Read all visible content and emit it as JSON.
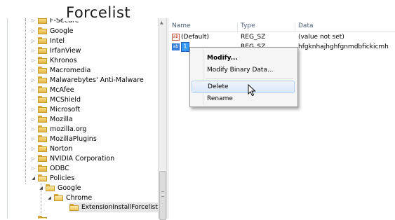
{
  "caption": "Forcelist",
  "tree": {
    "items": [
      {
        "label": "F-Secure",
        "depth": 0,
        "expander": "right",
        "open": false
      },
      {
        "label": "Google",
        "depth": 0,
        "expander": "right",
        "open": false
      },
      {
        "label": "Intel",
        "depth": 0,
        "expander": "right",
        "open": false
      },
      {
        "label": "IrfanView",
        "depth": 0,
        "expander": "right",
        "open": false
      },
      {
        "label": "Khronos",
        "depth": 0,
        "expander": "right",
        "open": false
      },
      {
        "label": "Macromedia",
        "depth": 0,
        "expander": "right",
        "open": false
      },
      {
        "label": "Malwarebytes' Anti-Malware",
        "depth": 0,
        "expander": "right",
        "open": false
      },
      {
        "label": "McAfee",
        "depth": 0,
        "expander": "right",
        "open": false
      },
      {
        "label": "MCShield",
        "depth": 0,
        "expander": "none",
        "open": false
      },
      {
        "label": "Microsoft",
        "depth": 0,
        "expander": "right",
        "open": false
      },
      {
        "label": "Mozilla",
        "depth": 0,
        "expander": "right",
        "open": false
      },
      {
        "label": "mozilla.org",
        "depth": 0,
        "expander": "right",
        "open": false
      },
      {
        "label": "MozillaPlugins",
        "depth": 0,
        "expander": "right",
        "open": false
      },
      {
        "label": "Norton",
        "depth": 0,
        "expander": "right",
        "open": false
      },
      {
        "label": "NVIDIA Corporation",
        "depth": 0,
        "expander": "right",
        "open": false
      },
      {
        "label": "ODBC",
        "depth": 0,
        "expander": "right",
        "open": false
      },
      {
        "label": "Policies",
        "depth": 0,
        "expander": "down",
        "open": true
      },
      {
        "label": "Google",
        "depth": 1,
        "expander": "down",
        "open": true
      },
      {
        "label": "Chrome",
        "depth": 2,
        "expander": "down",
        "open": true
      },
      {
        "label": "ExtensionInstallForcelist",
        "depth": 3,
        "expander": "none",
        "open": true,
        "selected": true
      }
    ]
  },
  "values": {
    "columns": [
      "Name",
      "Type",
      "Data"
    ],
    "rows": [
      {
        "name": "(Default)",
        "type": "REG_SZ",
        "data": "(value not set)"
      },
      {
        "name": "1",
        "type": "REG_SZ",
        "data": "hfgknhajhghfgnmdbfickicmh"
      }
    ]
  },
  "context_menu": {
    "items": [
      {
        "label": "Modify...",
        "bold": true
      },
      {
        "label": "Modify Binary Data...",
        "bold": false
      },
      {
        "label": "Delete",
        "bold": false,
        "hover": true
      },
      {
        "label": "Rename",
        "bold": false
      }
    ]
  },
  "colors": {
    "folder": "#e3b444",
    "selection": "#3399ff",
    "header_text": "#4c607a"
  }
}
